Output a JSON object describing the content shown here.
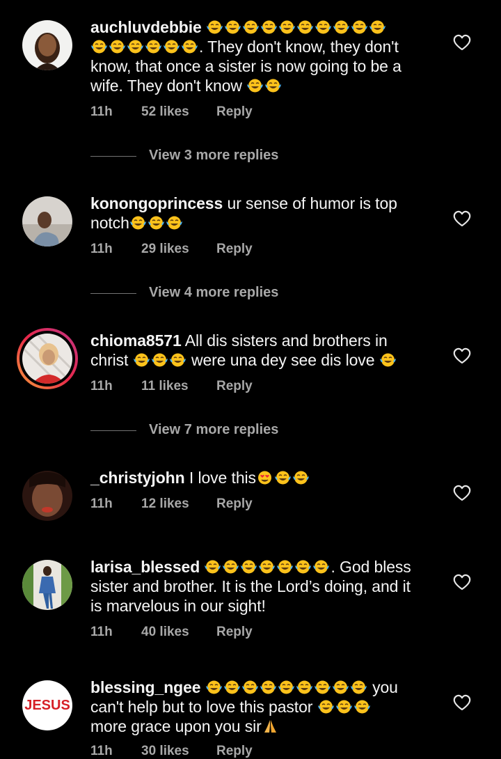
{
  "comments": [
    {
      "username": "auchluvdebbie",
      "lines": [
        {
          "pre": "",
          "emoji_count": 10,
          "post": ""
        },
        {
          "pre": "",
          "emoji_count": 6,
          "post": ". They don't know, they don't"
        },
        {
          "pre": "know, that once a sister is now going to be a",
          "emoji_count": 0,
          "post": ""
        },
        {
          "pre": "wife. They don't know ",
          "emoji_count": 2,
          "post": ""
        }
      ],
      "time": "11h",
      "likes": "52 likes",
      "reply": "Reply",
      "view_replies": "View 3 more replies"
    },
    {
      "username": "konongoprincess",
      "line1_text": "ur sense of humor is top",
      "line2_text": "notch",
      "time": "11h",
      "likes": "29 likes",
      "reply": "Reply",
      "view_replies": "View 4 more replies"
    },
    {
      "username": "chioma8571",
      "line1_text": "All dis sisters and brothers in",
      "line2_pre": "christ ",
      "line2_mid": " were una dey see dis love ",
      "time": "11h",
      "likes": "11 likes",
      "reply": "Reply",
      "view_replies": "View 7 more replies"
    },
    {
      "username": "_christyjohn",
      "line1_text": "I love this",
      "time": "11h",
      "likes": "12 likes",
      "reply": "Reply"
    },
    {
      "username": "larisa_blessed",
      "line1_post": ". God bless",
      "line2_text": "sister and brother. It is the Lord’s doing, and it",
      "line3_text": "is marvelous in our sight!",
      "time": "11h",
      "likes": "40 likes",
      "reply": "Reply"
    },
    {
      "username": "blessing_ngee",
      "avatar_text": "JESUS",
      "line1_post": " you",
      "line2_text": "can't help but to love this pastor ",
      "line3_text": "more grace upon you sir",
      "time": "11h",
      "likes": "30 likes",
      "reply": "Reply"
    }
  ],
  "icons": {
    "emoji": "face-with-tears-of-joy-icon",
    "heart_eyes": "smiling-face-with-heart-eyes-icon",
    "pray": "folded-hands-icon",
    "like": "heart-outline-icon"
  },
  "colors": {
    "background": "#000000",
    "text": "#f5f5f5",
    "secondary": "#a8a8a8",
    "avatar_brand_red": "#d61f26"
  }
}
